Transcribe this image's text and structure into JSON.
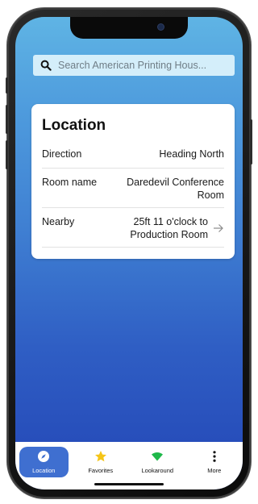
{
  "search": {
    "placeholder": "Search American Printing Hous..."
  },
  "location_card": {
    "title": "Location",
    "rows": [
      {
        "label": "Direction",
        "value": "Heading North"
      },
      {
        "label": "Room name",
        "value": "Daredevil Conference Room"
      },
      {
        "label": "Nearby",
        "value": "25ft 11 o'clock to Production Room"
      }
    ]
  },
  "bottom_nav": {
    "items": [
      {
        "label": "Location",
        "icon": "compass-icon",
        "active": true
      },
      {
        "label": "Favorites",
        "icon": "star-icon",
        "active": false
      },
      {
        "label": "Lookaround",
        "icon": "wifi-signal-icon",
        "active": false
      },
      {
        "label": "More",
        "icon": "more-vertical-icon",
        "active": false
      }
    ]
  },
  "colors": {
    "accent": "#3f6fd0",
    "star": "#f5c518",
    "lookaround": "#1fb84a",
    "search_bg": "#d4eefa",
    "gradient_top": "#5fb4e4",
    "gradient_bottom": "#2346b6"
  }
}
